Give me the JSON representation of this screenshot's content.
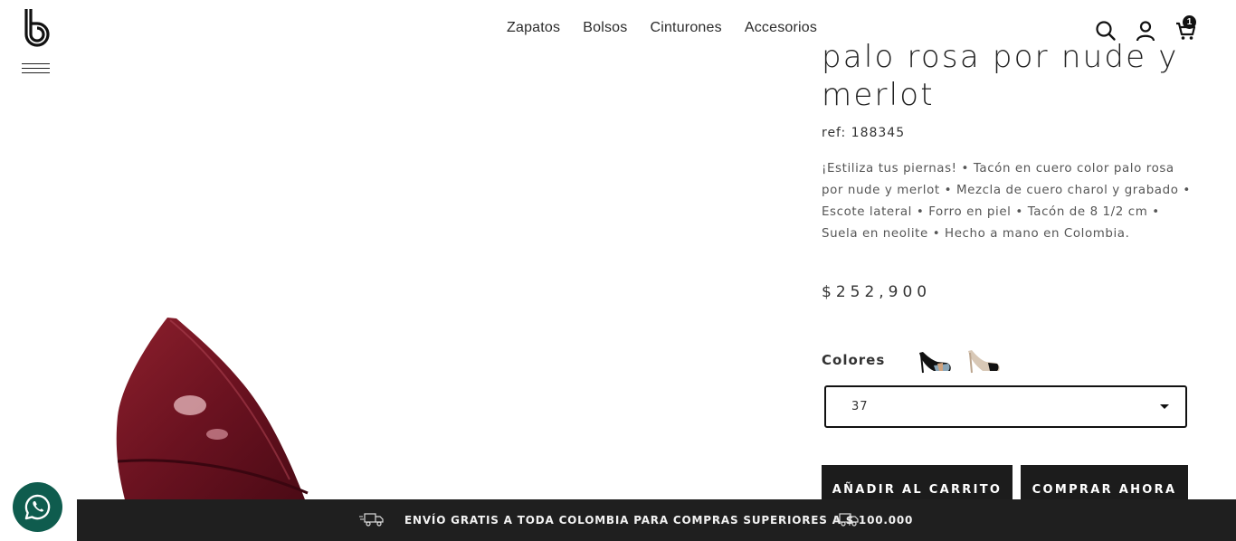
{
  "brand": {
    "logo_alt": "b"
  },
  "nav": {
    "items": [
      {
        "label": "Zapatos"
      },
      {
        "label": "Bolsos"
      },
      {
        "label": "Cinturones"
      },
      {
        "label": "Accesorios"
      }
    ]
  },
  "header": {
    "icons": [
      "search-icon",
      "user-icon",
      "cart-icon"
    ],
    "cart_count": "1"
  },
  "product": {
    "title_line1": "palo rosa por nude y",
    "title_line2": "merlot",
    "ref_label": "ref:",
    "ref_value": "188345",
    "description": "¡Estiliza tus piernas! • Tacón en cuero color palo rosa por nude y merlot • Mezcla de cuero charol y grabado • Escote lateral • Forro en piel • Tacón de 8 1/2 cm • Suela en neolite • Hecho a mano en Colombia.",
    "price": "$252,900",
    "colors_label": "Colores",
    "size_selected": "37",
    "add_to_cart": "AÑADIR AL CARRITO",
    "buy_now": "COMPRAR AHORA"
  },
  "banner": {
    "text": "ENVÍO GRATIS A TODA COLOMBIA PARA COMPRAS SUPERIORES A $ 100.000"
  },
  "colors": {
    "accent": "#1c1c1c",
    "banner_bg": "#1f1f1f",
    "whatsapp": "#0f5c4e",
    "merlot": "#7a1a24"
  }
}
